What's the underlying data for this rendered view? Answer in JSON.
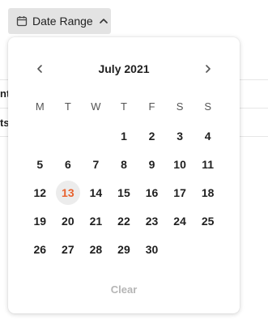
{
  "trigger": {
    "label": "Date Range",
    "icon": "calendar-icon"
  },
  "background": {
    "fragment_1": "nt",
    "fragment_2": "ts"
  },
  "calendar": {
    "month_label": "July 2021",
    "weekdays": [
      "M",
      "T",
      "W",
      "T",
      "F",
      "S",
      "S"
    ],
    "leading_blanks": 3,
    "days": [
      "1",
      "2",
      "3",
      "4",
      "5",
      "6",
      "7",
      "8",
      "9",
      "10",
      "11",
      "12",
      "13",
      "14",
      "15",
      "16",
      "17",
      "18",
      "19",
      "20",
      "21",
      "22",
      "23",
      "24",
      "25",
      "26",
      "27",
      "28",
      "29",
      "30"
    ],
    "today": "13",
    "today_color": "#e8622e",
    "clear_label": "Clear"
  }
}
